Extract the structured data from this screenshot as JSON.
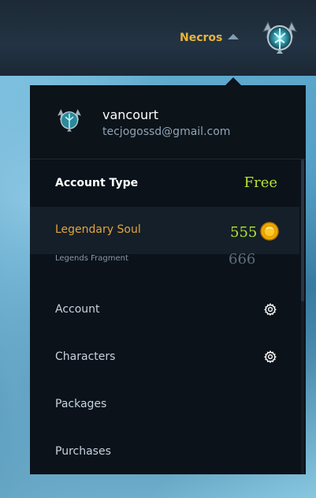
{
  "header": {
    "username": "Necros",
    "avatar_icon": "emblem-icon",
    "dropdown_icon": "caret-up-icon"
  },
  "profile": {
    "name": "vancourt",
    "email": "tecjogossd@gmail.com"
  },
  "account_type": {
    "label": "Account Type",
    "value": "Free"
  },
  "legendary_soul": {
    "label": "Legendary Soul",
    "value": "555",
    "icon": "gold-coin-icon"
  },
  "legends_fragment": {
    "label": "Legends Fragment",
    "value": "666"
  },
  "menu": {
    "account": "Account",
    "characters": "Characters",
    "packages": "Packages",
    "purchases": "Purchases"
  },
  "colors": {
    "accent_gold": "#e8b53a",
    "value_green": "#b4e336",
    "panel_bg": "#0b121a"
  }
}
